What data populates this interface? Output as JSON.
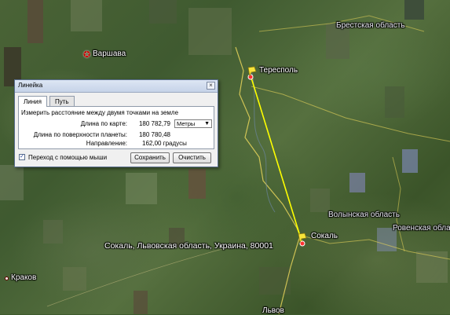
{
  "map": {
    "cities": [
      {
        "name": "Варшава",
        "type": "capital"
      },
      {
        "name": "Тересполь",
        "type": "town"
      },
      {
        "name": "Сокаль",
        "type": "town"
      },
      {
        "name": "Краков",
        "type": "town"
      },
      {
        "name": "Львов",
        "type": "town"
      }
    ],
    "regions": [
      "Брестская область",
      "Волынская область",
      "Ровенская область"
    ],
    "search_result": "Сокаль, Львовская область, Украина, 80001",
    "measure_line_color": "#ffff00",
    "border_color": "#e6d45a"
  },
  "dialog": {
    "title": "Линейка",
    "close_icon": "×",
    "tabs": [
      {
        "label": "Линия",
        "active": true
      },
      {
        "label": "Путь",
        "active": false
      }
    ],
    "description": "Измерить расстояние между двумя точками на земле",
    "map_length_label": "Длина по карте:",
    "map_length_value": "180 782,79",
    "units": "Метры",
    "ground_length_label": "Длина по поверхности планеты:",
    "ground_length_value": "180 780,48",
    "heading_label": "Направление:",
    "heading_value": "162,00 градусы",
    "mouse_nav_label": "Переход с помощью мыши",
    "mouse_nav_checked": true,
    "save_label": "Сохранить",
    "clear_label": "Очистить"
  }
}
